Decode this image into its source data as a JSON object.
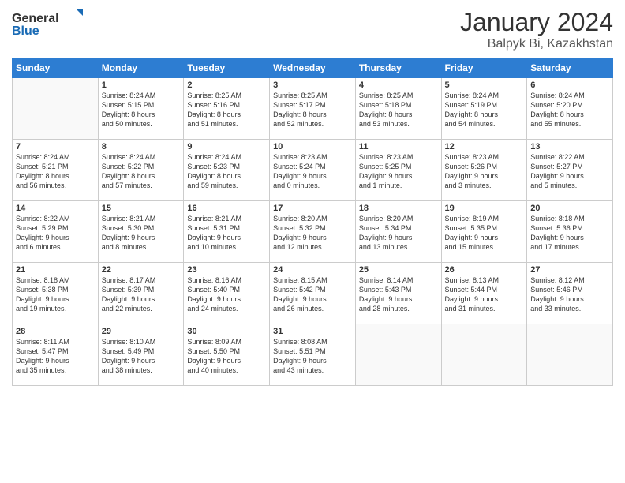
{
  "logo": {
    "general": "General",
    "blue": "Blue"
  },
  "title": "January 2024",
  "subtitle": "Balpyk Bi, Kazakhstan",
  "weekdays": [
    "Sunday",
    "Monday",
    "Tuesday",
    "Wednesday",
    "Thursday",
    "Friday",
    "Saturday"
  ],
  "weeks": [
    [
      {
        "day": "",
        "info": ""
      },
      {
        "day": "1",
        "info": "Sunrise: 8:24 AM\nSunset: 5:15 PM\nDaylight: 8 hours\nand 50 minutes."
      },
      {
        "day": "2",
        "info": "Sunrise: 8:25 AM\nSunset: 5:16 PM\nDaylight: 8 hours\nand 51 minutes."
      },
      {
        "day": "3",
        "info": "Sunrise: 8:25 AM\nSunset: 5:17 PM\nDaylight: 8 hours\nand 52 minutes."
      },
      {
        "day": "4",
        "info": "Sunrise: 8:25 AM\nSunset: 5:18 PM\nDaylight: 8 hours\nand 53 minutes."
      },
      {
        "day": "5",
        "info": "Sunrise: 8:24 AM\nSunset: 5:19 PM\nDaylight: 8 hours\nand 54 minutes."
      },
      {
        "day": "6",
        "info": "Sunrise: 8:24 AM\nSunset: 5:20 PM\nDaylight: 8 hours\nand 55 minutes."
      }
    ],
    [
      {
        "day": "7",
        "info": "Sunrise: 8:24 AM\nSunset: 5:21 PM\nDaylight: 8 hours\nand 56 minutes."
      },
      {
        "day": "8",
        "info": "Sunrise: 8:24 AM\nSunset: 5:22 PM\nDaylight: 8 hours\nand 57 minutes."
      },
      {
        "day": "9",
        "info": "Sunrise: 8:24 AM\nSunset: 5:23 PM\nDaylight: 8 hours\nand 59 minutes."
      },
      {
        "day": "10",
        "info": "Sunrise: 8:23 AM\nSunset: 5:24 PM\nDaylight: 9 hours\nand 0 minutes."
      },
      {
        "day": "11",
        "info": "Sunrise: 8:23 AM\nSunset: 5:25 PM\nDaylight: 9 hours\nand 1 minute."
      },
      {
        "day": "12",
        "info": "Sunrise: 8:23 AM\nSunset: 5:26 PM\nDaylight: 9 hours\nand 3 minutes."
      },
      {
        "day": "13",
        "info": "Sunrise: 8:22 AM\nSunset: 5:27 PM\nDaylight: 9 hours\nand 5 minutes."
      }
    ],
    [
      {
        "day": "14",
        "info": "Sunrise: 8:22 AM\nSunset: 5:29 PM\nDaylight: 9 hours\nand 6 minutes."
      },
      {
        "day": "15",
        "info": "Sunrise: 8:21 AM\nSunset: 5:30 PM\nDaylight: 9 hours\nand 8 minutes."
      },
      {
        "day": "16",
        "info": "Sunrise: 8:21 AM\nSunset: 5:31 PM\nDaylight: 9 hours\nand 10 minutes."
      },
      {
        "day": "17",
        "info": "Sunrise: 8:20 AM\nSunset: 5:32 PM\nDaylight: 9 hours\nand 12 minutes."
      },
      {
        "day": "18",
        "info": "Sunrise: 8:20 AM\nSunset: 5:34 PM\nDaylight: 9 hours\nand 13 minutes."
      },
      {
        "day": "19",
        "info": "Sunrise: 8:19 AM\nSunset: 5:35 PM\nDaylight: 9 hours\nand 15 minutes."
      },
      {
        "day": "20",
        "info": "Sunrise: 8:18 AM\nSunset: 5:36 PM\nDaylight: 9 hours\nand 17 minutes."
      }
    ],
    [
      {
        "day": "21",
        "info": "Sunrise: 8:18 AM\nSunset: 5:38 PM\nDaylight: 9 hours\nand 19 minutes."
      },
      {
        "day": "22",
        "info": "Sunrise: 8:17 AM\nSunset: 5:39 PM\nDaylight: 9 hours\nand 22 minutes."
      },
      {
        "day": "23",
        "info": "Sunrise: 8:16 AM\nSunset: 5:40 PM\nDaylight: 9 hours\nand 24 minutes."
      },
      {
        "day": "24",
        "info": "Sunrise: 8:15 AM\nSunset: 5:42 PM\nDaylight: 9 hours\nand 26 minutes."
      },
      {
        "day": "25",
        "info": "Sunrise: 8:14 AM\nSunset: 5:43 PM\nDaylight: 9 hours\nand 28 minutes."
      },
      {
        "day": "26",
        "info": "Sunrise: 8:13 AM\nSunset: 5:44 PM\nDaylight: 9 hours\nand 31 minutes."
      },
      {
        "day": "27",
        "info": "Sunrise: 8:12 AM\nSunset: 5:46 PM\nDaylight: 9 hours\nand 33 minutes."
      }
    ],
    [
      {
        "day": "28",
        "info": "Sunrise: 8:11 AM\nSunset: 5:47 PM\nDaylight: 9 hours\nand 35 minutes."
      },
      {
        "day": "29",
        "info": "Sunrise: 8:10 AM\nSunset: 5:49 PM\nDaylight: 9 hours\nand 38 minutes."
      },
      {
        "day": "30",
        "info": "Sunrise: 8:09 AM\nSunset: 5:50 PM\nDaylight: 9 hours\nand 40 minutes."
      },
      {
        "day": "31",
        "info": "Sunrise: 8:08 AM\nSunset: 5:51 PM\nDaylight: 9 hours\nand 43 minutes."
      },
      {
        "day": "",
        "info": ""
      },
      {
        "day": "",
        "info": ""
      },
      {
        "day": "",
        "info": ""
      }
    ]
  ]
}
